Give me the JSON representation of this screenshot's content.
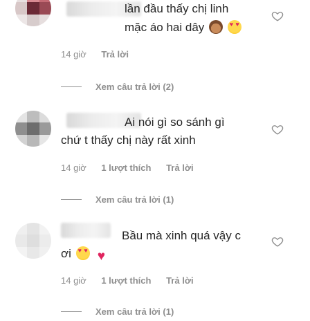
{
  "comments": [
    {
      "text_lines": [
        "lần đầu thấy chị linh",
        "mặc áo hai dây"
      ],
      "emojis": [
        "see-no-evil-monkey",
        "heart-eyes-face"
      ],
      "time": "14 giờ",
      "likes": "",
      "reply": "Trả lời",
      "view_replies": "Xem câu trả lời (2)",
      "avatar_colors": [
        "#e8e0e0",
        "#d88a92",
        "#c46a74",
        "#d8c8c8",
        "#6b2a36",
        "#9a4a55",
        "#ece6e6",
        "#d7cccc",
        "#e6dede"
      ]
    },
    {
      "text_lines": [
        "Ai nói gì so sánh gì",
        "chứ t thấy chị này rất xinh"
      ],
      "emojis": [],
      "time": "14 giờ",
      "likes": "1 lượt thích",
      "reply": "Trả lời",
      "view_replies": "Xem câu trả lời (1)",
      "avatar_colors": [
        "#e4e4e4",
        "#bdbdbd",
        "#dcdcdc",
        "#8f8f8f",
        "#6d6d6d",
        "#9a9a9a",
        "#d2d2d2",
        "#b8b8b8",
        "#e6e6e6"
      ]
    },
    {
      "text_lines": [
        "Bầu mà xinh quá vậy c",
        "ơi"
      ],
      "emojis": [
        "heart-eyes-face",
        "red-heart"
      ],
      "time": "14 giờ",
      "likes": "1 lượt thích",
      "reply": "Trả lời",
      "view_replies": "Xem câu trả lời (1)",
      "avatar_colors": [
        "#efefef",
        "#e4e4e4",
        "#f2f2f2",
        "#e9e9e9",
        "#dedede",
        "#ececec",
        "#f3f3f3",
        "#e8e8e8",
        "#f0f0f0"
      ]
    }
  ]
}
